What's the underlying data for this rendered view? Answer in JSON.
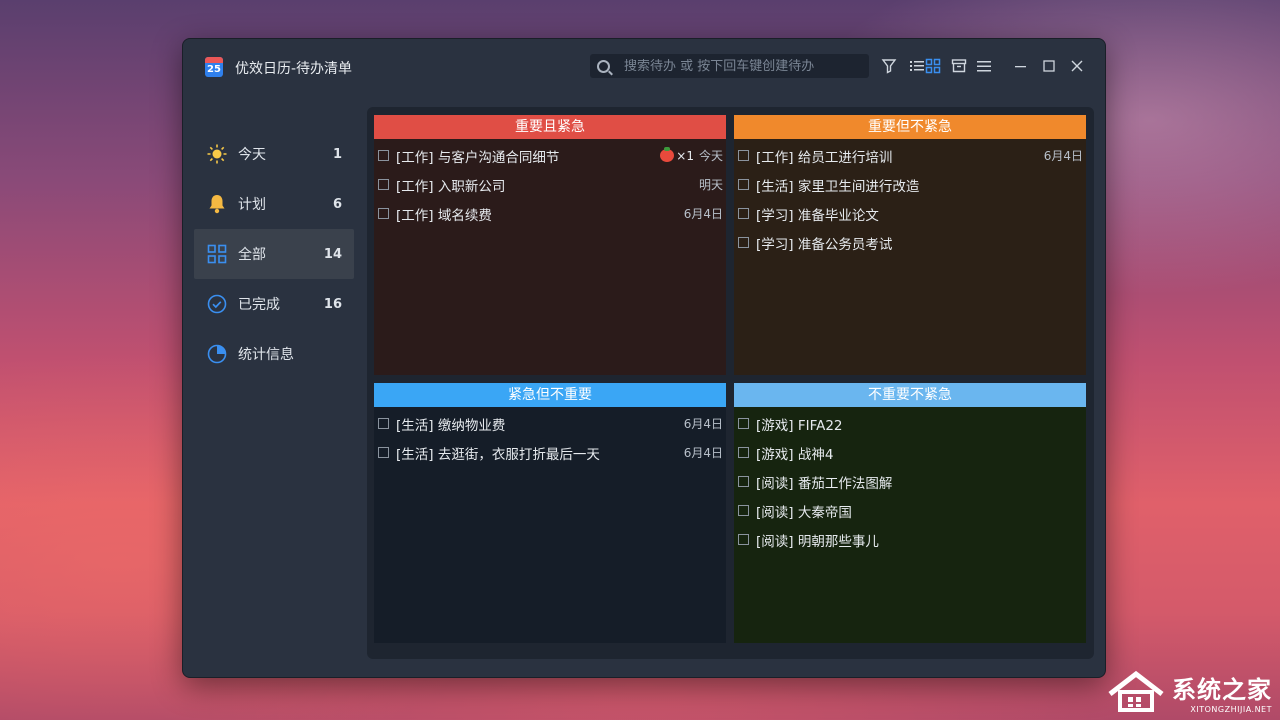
{
  "app": {
    "icon_text": "25",
    "title": "优效日历-待办清单"
  },
  "search": {
    "placeholder": "搜索待办 或 按下回车键创建待办"
  },
  "sidebar": {
    "items": [
      {
        "label": "今天",
        "count": "1",
        "icon": "sun-icon"
      },
      {
        "label": "计划",
        "count": "6",
        "icon": "bell-icon"
      },
      {
        "label": "全部",
        "count": "14",
        "icon": "grid-icon"
      },
      {
        "label": "已完成",
        "count": "16",
        "icon": "check-circle-icon"
      },
      {
        "label": "统计信息",
        "count": "",
        "icon": "pie-chart-icon"
      }
    ],
    "active_index": 2
  },
  "quadrants": [
    {
      "title": "重要且紧急",
      "color": "#e04e45",
      "tasks": [
        {
          "text": "[工作] 与客户沟通合同细节",
          "date": "今天",
          "pomodoro": "×1"
        },
        {
          "text": "[工作] 入职新公司",
          "date": "明天"
        },
        {
          "text": "[工作] 域名续费",
          "date": "6月4日"
        }
      ]
    },
    {
      "title": "重要但不紧急",
      "color": "#f0892c",
      "tasks": [
        {
          "text": "[工作] 给员工进行培训",
          "date": "6月4日"
        },
        {
          "text": "[生活] 家里卫生间进行改造",
          "date": ""
        },
        {
          "text": "[学习] 准备毕业论文",
          "date": ""
        },
        {
          "text": "[学习] 准备公务员考试",
          "date": ""
        }
      ]
    },
    {
      "title": "紧急但不重要",
      "color": "#3aa6f5",
      "tasks": [
        {
          "text": "[生活] 缴纳物业费",
          "date": "6月4日"
        },
        {
          "text": "[生活] 去逛街，衣服打折最后一天",
          "date": "6月4日"
        }
      ]
    },
    {
      "title": "不重要不紧急",
      "color": "#6ab6ef",
      "tasks": [
        {
          "text": "[游戏] FIFA22",
          "date": ""
        },
        {
          "text": "[游戏] 战神4",
          "date": ""
        },
        {
          "text": "[阅读] 番茄工作法图解",
          "date": ""
        },
        {
          "text": "[阅读] 大秦帝国",
          "date": ""
        },
        {
          "text": "[阅读] 明朝那些事儿",
          "date": ""
        }
      ]
    }
  ],
  "watermark": {
    "main": "系统之家",
    "sub": "XITONGZHIJIA.NET"
  }
}
